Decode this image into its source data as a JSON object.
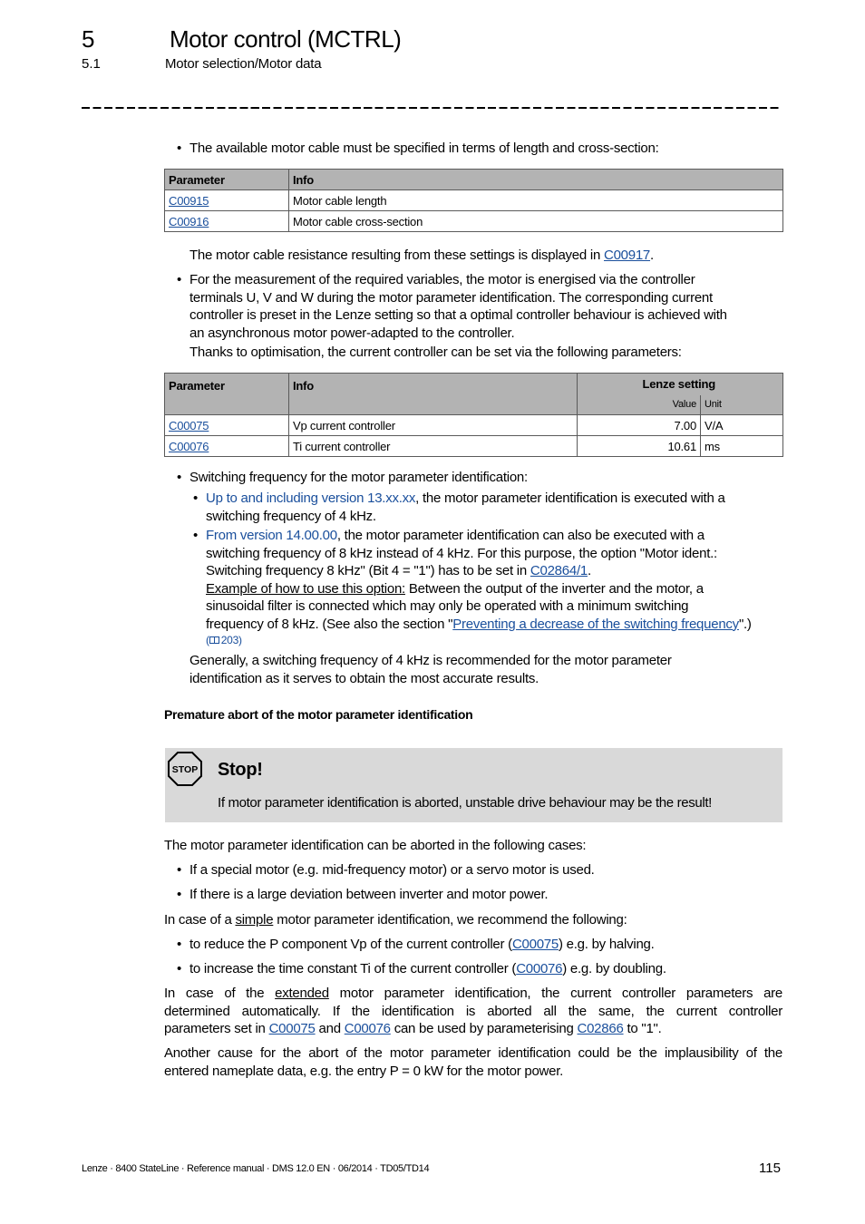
{
  "header": {
    "chapter_number": "5",
    "chapter_title": "Motor control (MCTRL)",
    "section_number": "5.1",
    "section_title": "Motor selection/Motor data"
  },
  "intro_bullet": "The available motor cable must be specified in terms of length and cross-section:",
  "table1": {
    "headers": [
      "Parameter",
      "Info"
    ],
    "rows": [
      {
        "param": "C00915",
        "info": "Motor cable length"
      },
      {
        "param": "C00916",
        "info": "Motor cable cross-section"
      }
    ]
  },
  "cable_resistance": {
    "text_before": "The motor cable resistance resulting from these settings is displayed in ",
    "link": "C00917",
    "text_after": "."
  },
  "measurement_bullet": {
    "lines": [
      "For the measurement of the required variables, the motor is energised via the controller",
      "terminals U, V and W during the motor parameter identification. The corresponding current",
      "controller is preset in the Lenze setting so that a optimal controller behaviour is achieved with",
      "an asynchronous motor power-adapted to the controller."
    ],
    "followup": "Thanks to optimisation, the current controller can be set via the following parameters:"
  },
  "table2": {
    "headers": [
      "Parameter",
      "Info",
      "Lenze setting"
    ],
    "subheaders": [
      "Value",
      "Unit"
    ],
    "rows": [
      {
        "param": "C00075",
        "info": "Vp current controller",
        "value": "7.00",
        "unit": "V/A"
      },
      {
        "param": "C00076",
        "info": "Ti current controller",
        "value": "10.61",
        "unit": "ms"
      }
    ]
  },
  "switching": {
    "bullet": "Switching frequency for the motor parameter identification:",
    "sub1": {
      "version_link": "Up to and including version 13.xx.xx",
      "text_line1": ", the motor parameter identification is executed with a",
      "text_line2": "switching frequency of 4 kHz."
    },
    "sub2": {
      "version_link": "From version 14.00.00",
      "text_line1": ", the motor parameter identification can also be executed with a",
      "text_line2": "switching frequency of 8 kHz instead of 4 kHz. For this purpose, the option \"Motor ident.:",
      "text_line3": "Switching frequency 8 kHz\" (Bit 4 = \"1\") has to be set in ",
      "param_link": "C02864/1",
      "text_line3_end": ".",
      "example_label": "Example of how to use this option:",
      "example_line1": " Between the output of the inverter and the motor, a",
      "example_line2": "sinusoidal filter is connected which may only be operated with a minimum switching",
      "example_line3": "frequency of 8 kHz. (See also the section \"",
      "section_link": "Preventing a decrease of the switching frequency",
      "example_line3_end": "\".)",
      "page_ref_icon": "book-icon",
      "page_ref": "203"
    },
    "general_line1": "Generally, a switching frequency of 4 kHz is recommended for the motor parameter",
    "general_line2": "identification as it serves to obtain the most accurate results."
  },
  "premature_heading": "Premature abort of the motor parameter identification",
  "stop_box": {
    "icon": "stop-sign-icon",
    "icon_text": "STOP",
    "title": "Stop!",
    "text": "If motor parameter identification is aborted, unstable drive behaviour may be the result!"
  },
  "abort_cases": {
    "intro": "The motor parameter identification can be aborted in the following cases:",
    "items": [
      "If a special motor (e.g. mid-frequency motor) or a servo motor is used.",
      "If there is a large deviation between inverter and motor power."
    ]
  },
  "simple": {
    "text_before": "In case of a ",
    "underlined": "simple",
    "text_after": " motor parameter identification, we recommend the following:",
    "items": [
      {
        "before": "to reduce the P component Vp of the current controller (",
        "link": "C00075",
        "after": ") e.g. by halving."
      },
      {
        "before": "to increase the time constant Ti of the current controller (",
        "link": "C00076",
        "after": ") e.g. by doubling."
      }
    ]
  },
  "extended": {
    "text_before": "In case of the ",
    "underlined": "extended",
    "line1_after": " motor parameter identification, the current controller parameters are",
    "line2": "determined automatically. If the identification is aborted all the same, the current controller",
    "line3_before": "parameters set in ",
    "link1": "C00075",
    "line3_and": " and ",
    "link2": "C00076",
    "line3_mid": " can be used by parameterising ",
    "link3": "C02866",
    "line3_end": " to \"1\"."
  },
  "another_cause": {
    "line1": "Another cause for the abort of the motor parameter identification could be the implausibility of the",
    "line2": "entered nameplate data, e.g. the entry P = 0 kW for the motor power."
  },
  "footer": {
    "left": "Lenze · 8400 StateLine · Reference manual · DMS 12.0 EN · 06/2014 · TD05/TD14",
    "page_number": "115"
  }
}
